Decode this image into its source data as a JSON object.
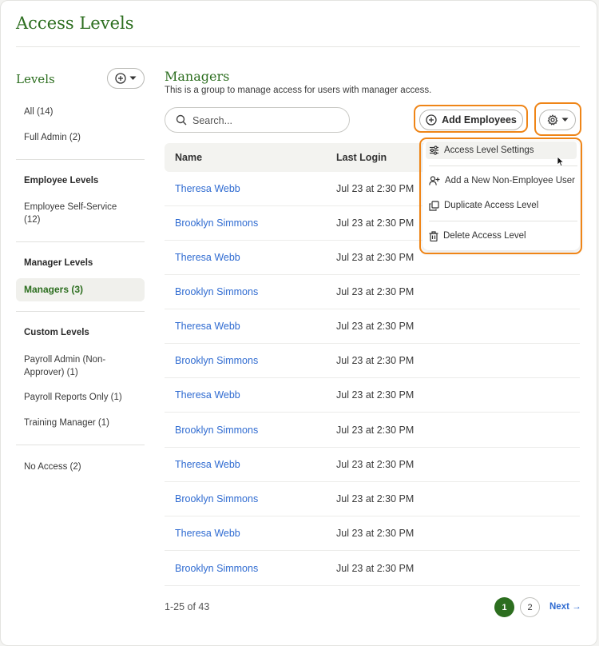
{
  "page": {
    "title": "Access Levels"
  },
  "sidebar": {
    "heading": "Levels",
    "all": "All (14)",
    "full_admin": "Full Admin (2)",
    "employee_group": "Employee Levels",
    "employee_self_service_1": "Employee Self-Service",
    "employee_self_service_2": "(12)",
    "manager_group": "Manager Levels",
    "managers": "Managers (3)",
    "custom_group": "Custom Levels",
    "payroll_admin_1": "Payroll Admin (Non-",
    "payroll_admin_2": "Approver) (1)",
    "payroll_reports": "Payroll Reports Only (1)",
    "training_manager": "Training Manager (1)",
    "no_access": "No Access (2)"
  },
  "main": {
    "title": "Managers",
    "description": "This is a group to manage access for users with manager access.",
    "search_placeholder": "Search...",
    "add_employees_label": "Add Employees",
    "columns": {
      "name": "Name",
      "last_login": "Last Login"
    },
    "rows": [
      {
        "name": "Theresa Webb",
        "last_login": "Jul 23 at 2:30 PM"
      },
      {
        "name": "Brooklyn Simmons",
        "last_login": "Jul 23 at 2:30 PM"
      },
      {
        "name": "Theresa Webb",
        "last_login": "Jul 23 at 2:30 PM"
      },
      {
        "name": "Brooklyn Simmons",
        "last_login": "Jul 23 at 2:30 PM"
      },
      {
        "name": "Theresa Webb",
        "last_login": "Jul 23 at 2:30 PM"
      },
      {
        "name": "Brooklyn Simmons",
        "last_login": "Jul 23 at 2:30 PM"
      },
      {
        "name": "Theresa Webb",
        "last_login": "Jul 23 at 2:30 PM"
      },
      {
        "name": "Brooklyn Simmons",
        "last_login": "Jul 23 at 2:30 PM"
      },
      {
        "name": "Theresa Webb",
        "last_login": "Jul 23 at 2:30 PM"
      },
      {
        "name": "Brooklyn Simmons",
        "last_login": "Jul 23 at 2:30 PM"
      },
      {
        "name": "Theresa Webb",
        "last_login": "Jul 23 at 2:30 PM"
      },
      {
        "name": "Brooklyn Simmons",
        "last_login": "Jul 23 at 2:30 PM"
      }
    ]
  },
  "menu": {
    "settings": "Access Level Settings",
    "add_non_employee": "Add a New Non-Employee User",
    "duplicate": "Duplicate Access Level",
    "delete": "Delete Access Level"
  },
  "pagination": {
    "count": "1-25 of 43",
    "page_1": "1",
    "page_2": "2",
    "next": "Next →"
  },
  "colors": {
    "brand_green": "#2c6e1f",
    "link_blue": "#2f6bd1",
    "highlight_orange": "#ef8517"
  },
  "icons": [
    "plus-circle-icon",
    "chevron-down-icon",
    "search-icon",
    "gear-icon",
    "sliders-icon",
    "user-plus-icon",
    "copy-icon",
    "trash-icon",
    "cursor-icon"
  ]
}
